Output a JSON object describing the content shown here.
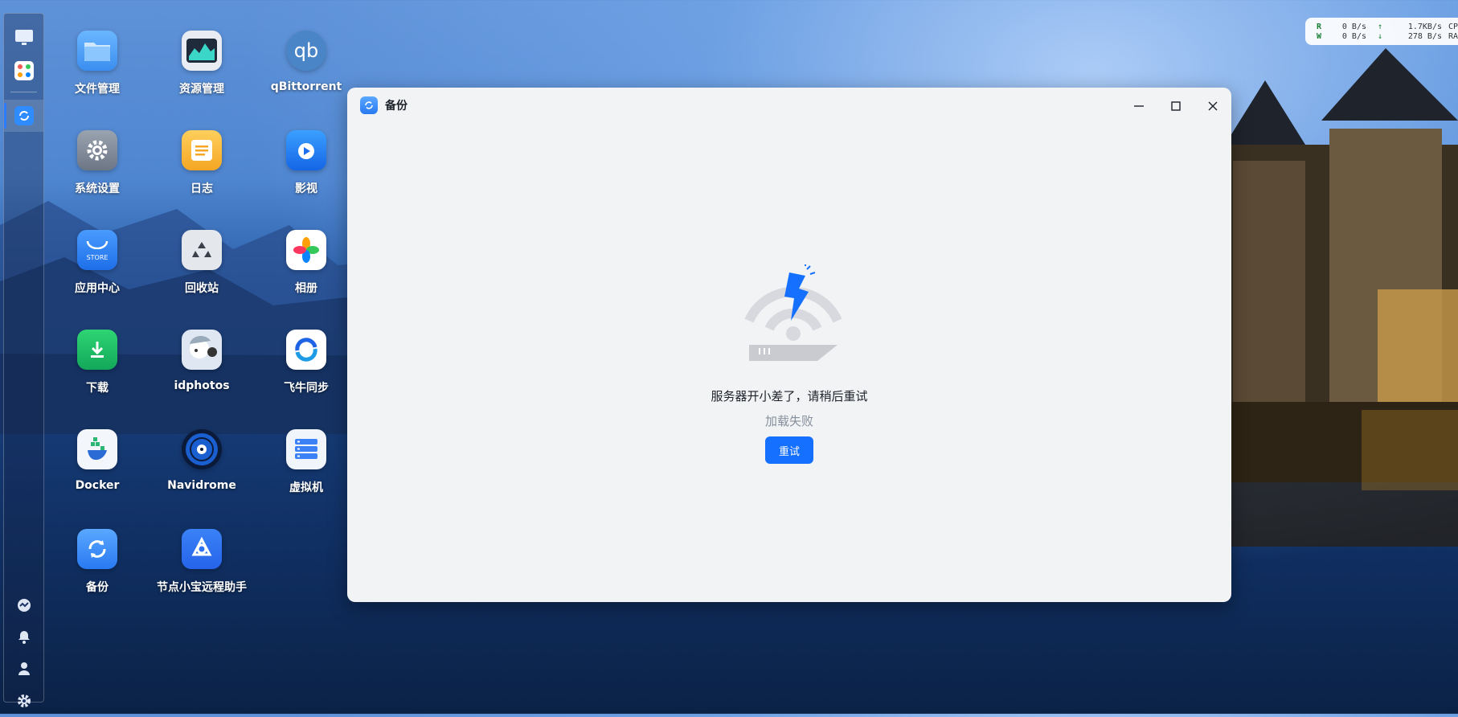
{
  "desktop": {
    "apps": [
      {
        "label": "文件管理",
        "icon": "folder-icon"
      },
      {
        "label": "资源管理",
        "icon": "resource-monitor-icon"
      },
      {
        "label": "qBittorrent",
        "icon": "qbittorrent-icon"
      },
      {
        "label": "系统设置",
        "icon": "gear-icon"
      },
      {
        "label": "日志",
        "icon": "log-icon"
      },
      {
        "label": "影视",
        "icon": "video-icon"
      },
      {
        "label": "应用中心",
        "icon": "store-icon",
        "icon_text": "STORE"
      },
      {
        "label": "回收站",
        "icon": "recycle-bin-icon"
      },
      {
        "label": "相册",
        "icon": "photos-icon"
      },
      {
        "label": "下载",
        "icon": "download-icon"
      },
      {
        "label": "idphotos",
        "icon": "idphotos-icon"
      },
      {
        "label": "飞牛同步",
        "icon": "sync-icon"
      },
      {
        "label": "Docker",
        "icon": "docker-icon"
      },
      {
        "label": "Navidrome",
        "icon": "navidrome-icon"
      },
      {
        "label": "虚拟机",
        "icon": "virtual-machine-icon"
      },
      {
        "label": "备份",
        "icon": "backup-icon"
      },
      {
        "label": "节点小宝远程助手",
        "icon": "remote-assistant-icon"
      }
    ]
  },
  "dock": {
    "top_items": [
      "desktop-icon",
      "app-grid-icon",
      "backup-icon"
    ],
    "bottom_items": [
      "network-icon",
      "bell-icon",
      "user-icon",
      "gear-icon"
    ]
  },
  "monitor": {
    "read_label": "R",
    "write_label": "W",
    "read_value": "0  B/s",
    "write_value": "0  B/s",
    "up_value": "1.7KB/s",
    "down_value": "278  B/s",
    "cpu_label": "CPU",
    "ram_label": "RAM"
  },
  "window": {
    "title": "备份",
    "error_message": "服务器开小差了，请稍后重试",
    "error_sub": "加载失败",
    "retry_label": "重试"
  },
  "colors": {
    "accent": "#1670ff",
    "window_bg": "#f2f3f5"
  }
}
